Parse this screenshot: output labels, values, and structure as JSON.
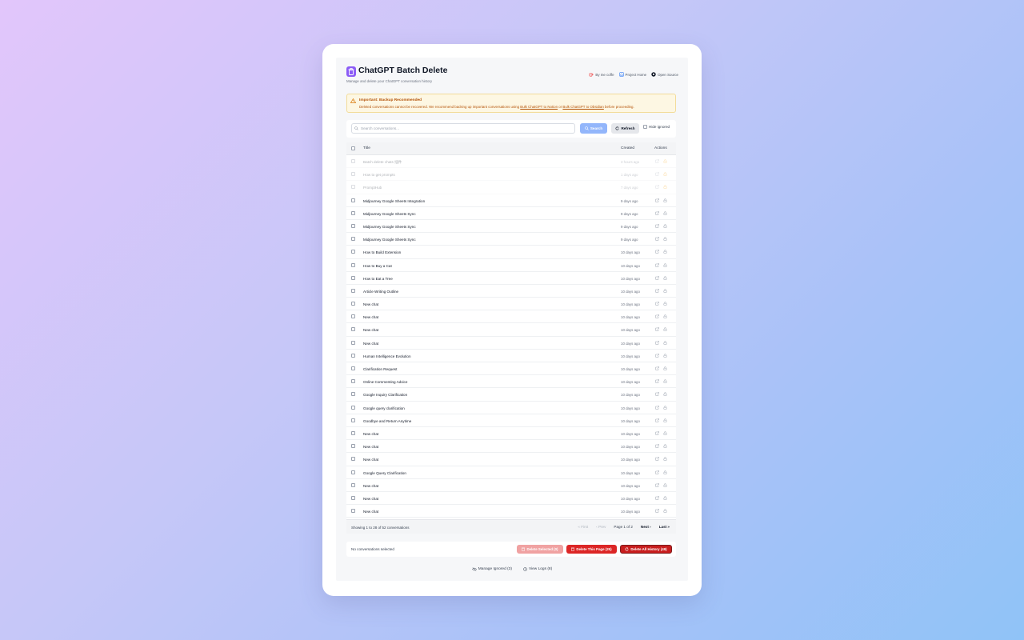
{
  "header": {
    "title": "ChatGPT Batch Delete",
    "subtitle": "Manage and delete your ChatGPT conversation history",
    "links": [
      {
        "label": "By me coffe",
        "icon": "coffee-icon"
      },
      {
        "label": "Project Home",
        "icon": "home-icon"
      },
      {
        "label": "Open Source",
        "icon": "github-icon"
      }
    ]
  },
  "warning": {
    "title": "Important: Backup Recommended",
    "body_prefix": "Deleted conversations cannot be recovered. We recommend backing up important conversations using ",
    "link1": "Bulk ChatGPT to Notion",
    "or": " or ",
    "link2": "Bulk ChatGPT to Obsidian",
    "body_suffix": " before proceeding."
  },
  "search": {
    "placeholder": "Search conversations...",
    "value": "",
    "search_label": "Search",
    "refresh_label": "Refresh",
    "hide_ignored_label": "Hide ignored"
  },
  "table": {
    "columns": {
      "title": "Title",
      "created": "Created",
      "actions": "Actions"
    },
    "rows": [
      {
        "title": "Batch delete chats 插件",
        "created": "3 hours ago",
        "ignored": true
      },
      {
        "title": "How to get prompts",
        "created": "1 days ago",
        "ignored": true
      },
      {
        "title": "PromptHub",
        "created": "7 days ago",
        "ignored": true
      },
      {
        "title": "Midjourney Google Sheets Integration",
        "created": "9 days ago",
        "ignored": false
      },
      {
        "title": "Midjourney Google Sheets Sync",
        "created": "9 days ago",
        "ignored": false
      },
      {
        "title": "Midjourney Google Sheets Sync",
        "created": "9 days ago",
        "ignored": false
      },
      {
        "title": "Midjourney Google Sheets Sync",
        "created": "9 days ago",
        "ignored": false
      },
      {
        "title": "How to Build Extension",
        "created": "10 days ago",
        "ignored": false
      },
      {
        "title": "How to Buy a Cat",
        "created": "10 days ago",
        "ignored": false
      },
      {
        "title": "How to Eat a Tree",
        "created": "10 days ago",
        "ignored": false
      },
      {
        "title": "Article Writing Outline",
        "created": "10 days ago",
        "ignored": false
      },
      {
        "title": "New chat",
        "created": "10 days ago",
        "ignored": false
      },
      {
        "title": "New chat",
        "created": "10 days ago",
        "ignored": false
      },
      {
        "title": "New chat",
        "created": "10 days ago",
        "ignored": false
      },
      {
        "title": "New chat",
        "created": "10 days ago",
        "ignored": false
      },
      {
        "title": "Human Intelligence Evolution",
        "created": "10 days ago",
        "ignored": false
      },
      {
        "title": "Clarification Request",
        "created": "10 days ago",
        "ignored": false
      },
      {
        "title": "Online Commenting Advice",
        "created": "10 days ago",
        "ignored": false
      },
      {
        "title": "Google Inquiry Clarification",
        "created": "10 days ago",
        "ignored": false
      },
      {
        "title": "Google query clarification",
        "created": "10 days ago",
        "ignored": false
      },
      {
        "title": "Goodbye and Return Anytime",
        "created": "10 days ago",
        "ignored": false
      },
      {
        "title": "New chat",
        "created": "10 days ago",
        "ignored": false
      },
      {
        "title": "New chat",
        "created": "10 days ago",
        "ignored": false
      },
      {
        "title": "New chat",
        "created": "10 days ago",
        "ignored": false
      },
      {
        "title": "Google Query Clarification",
        "created": "10 days ago",
        "ignored": false
      },
      {
        "title": "New chat",
        "created": "10 days ago",
        "ignored": false
      },
      {
        "title": "New chat",
        "created": "10 days ago",
        "ignored": false
      },
      {
        "title": "New chat",
        "created": "10 days ago",
        "ignored": false
      }
    ],
    "footer": {
      "showing": "Showing 1 to 28 of 52 conversations",
      "first": "First",
      "prev": "Prev",
      "page_info": "Page 1 of 2",
      "next": "Next",
      "last": "Last"
    }
  },
  "actions": {
    "selection_status": "No conversations selected",
    "delete_selected": "Delete Selected (0)",
    "delete_page": "Delete This Page (25)",
    "delete_all": "Delete All History (49)"
  },
  "bottom": {
    "manage_ignored": "Manage Ignored (3)",
    "view_logs": "View Logs (8)"
  },
  "colors": {
    "accent": "#8b5cf6",
    "primary_disabled": "#93b6fb",
    "danger": "#dc2626",
    "warning_bg": "#fdf7e3",
    "warning_text": "#b45309"
  }
}
